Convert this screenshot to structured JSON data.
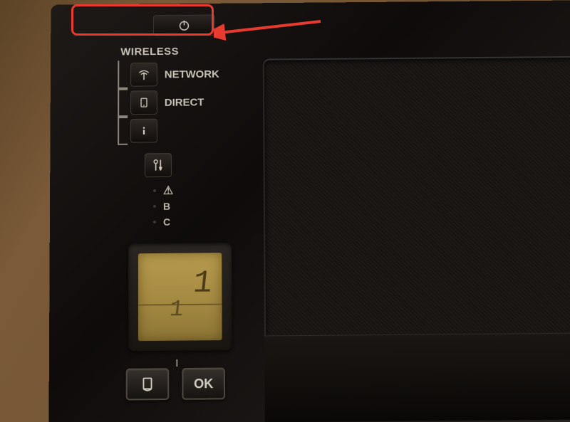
{
  "annotation": {
    "target": "power-button",
    "highlight_color": "#e63b2e"
  },
  "panel": {
    "wireless_header": "WIRELESS",
    "network_label": "NETWORK",
    "direct_label": "DIRECT",
    "status": {
      "b": "B",
      "c": "C"
    },
    "ok_label": "OK"
  },
  "lcd": {
    "main_digit": "1",
    "sub_digit": "1"
  }
}
